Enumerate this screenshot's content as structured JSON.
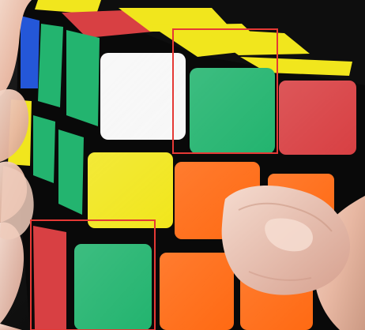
{
  "scene": {
    "subject": "rubiks-cube-in-hands",
    "sticker_colors": {
      "green": "#23b46f",
      "white": "#f7f7f7",
      "red": "#d84043",
      "yellow": "#f1e61d",
      "orange": "#ff6a13",
      "blue": "#2457d8",
      "black": "#090909"
    },
    "highlight_color": "#e53935",
    "highlight_boxes": [
      {
        "label": "highlight-top-right-green-sticker"
      },
      {
        "label": "highlight-bottom-left-green-sticker"
      }
    ]
  }
}
